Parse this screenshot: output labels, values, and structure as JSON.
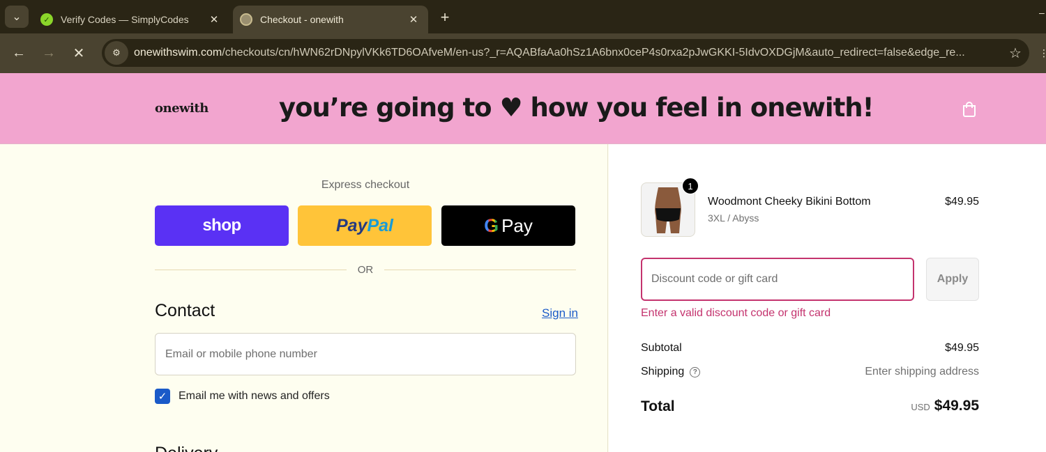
{
  "browser": {
    "tabs": [
      {
        "title": "Verify Codes — SimplyCodes",
        "icon": "simplycodes-favicon-icon",
        "active": false
      },
      {
        "title": "Checkout - onewith",
        "icon": "loading-favicon-icon",
        "active": true
      }
    ],
    "url_host": "onewithswim.com",
    "url_path": "/checkouts/cn/hWN62rDNpylVKk6TD6OAfveM/en-us?_r=AQABfaAa0hSz1A6bnx0ceP4s0rxa2pJwGKKI-5IdvOXDGjM&auto_redirect=false&edge_re..."
  },
  "header": {
    "logo": "onewith",
    "banner_before": "you’re going to",
    "banner_heart": "♥",
    "banner_after": "how you feel in onewith!"
  },
  "main": {
    "express_label": "Express checkout",
    "shop_label": "shop",
    "paypal_part1": "Pay",
    "paypal_part2": "Pal",
    "gpay_g": "G",
    "gpay_label": "Pay",
    "or_label": "OR",
    "contact_heading": "Contact",
    "sign_in": "Sign in",
    "email_placeholder": "Email or mobile phone number",
    "newsletter_label": "Email me with news and offers",
    "newsletter_checked": true,
    "delivery_heading": "Delivery"
  },
  "summary": {
    "item": {
      "quantity": "1",
      "name": "Woodmont Cheeky Bikini Bottom",
      "variant": "3XL / Abyss",
      "price": "$49.95"
    },
    "discount_placeholder": "Discount code or gift card",
    "apply_label": "Apply",
    "discount_error": "Enter a valid discount code or gift card",
    "subtotal_label": "Subtotal",
    "subtotal_value": "$49.95",
    "shipping_label": "Shipping",
    "shipping_value": "Enter shipping address",
    "total_label": "Total",
    "total_currency": "USD",
    "total_value": "$49.95"
  },
  "colors": {
    "header_pink": "#f2a5cf",
    "shop_purple": "#5a31f4",
    "paypal_yellow": "#ffc439",
    "error_red": "#c4336e",
    "link_blue": "#1a5ac8"
  }
}
